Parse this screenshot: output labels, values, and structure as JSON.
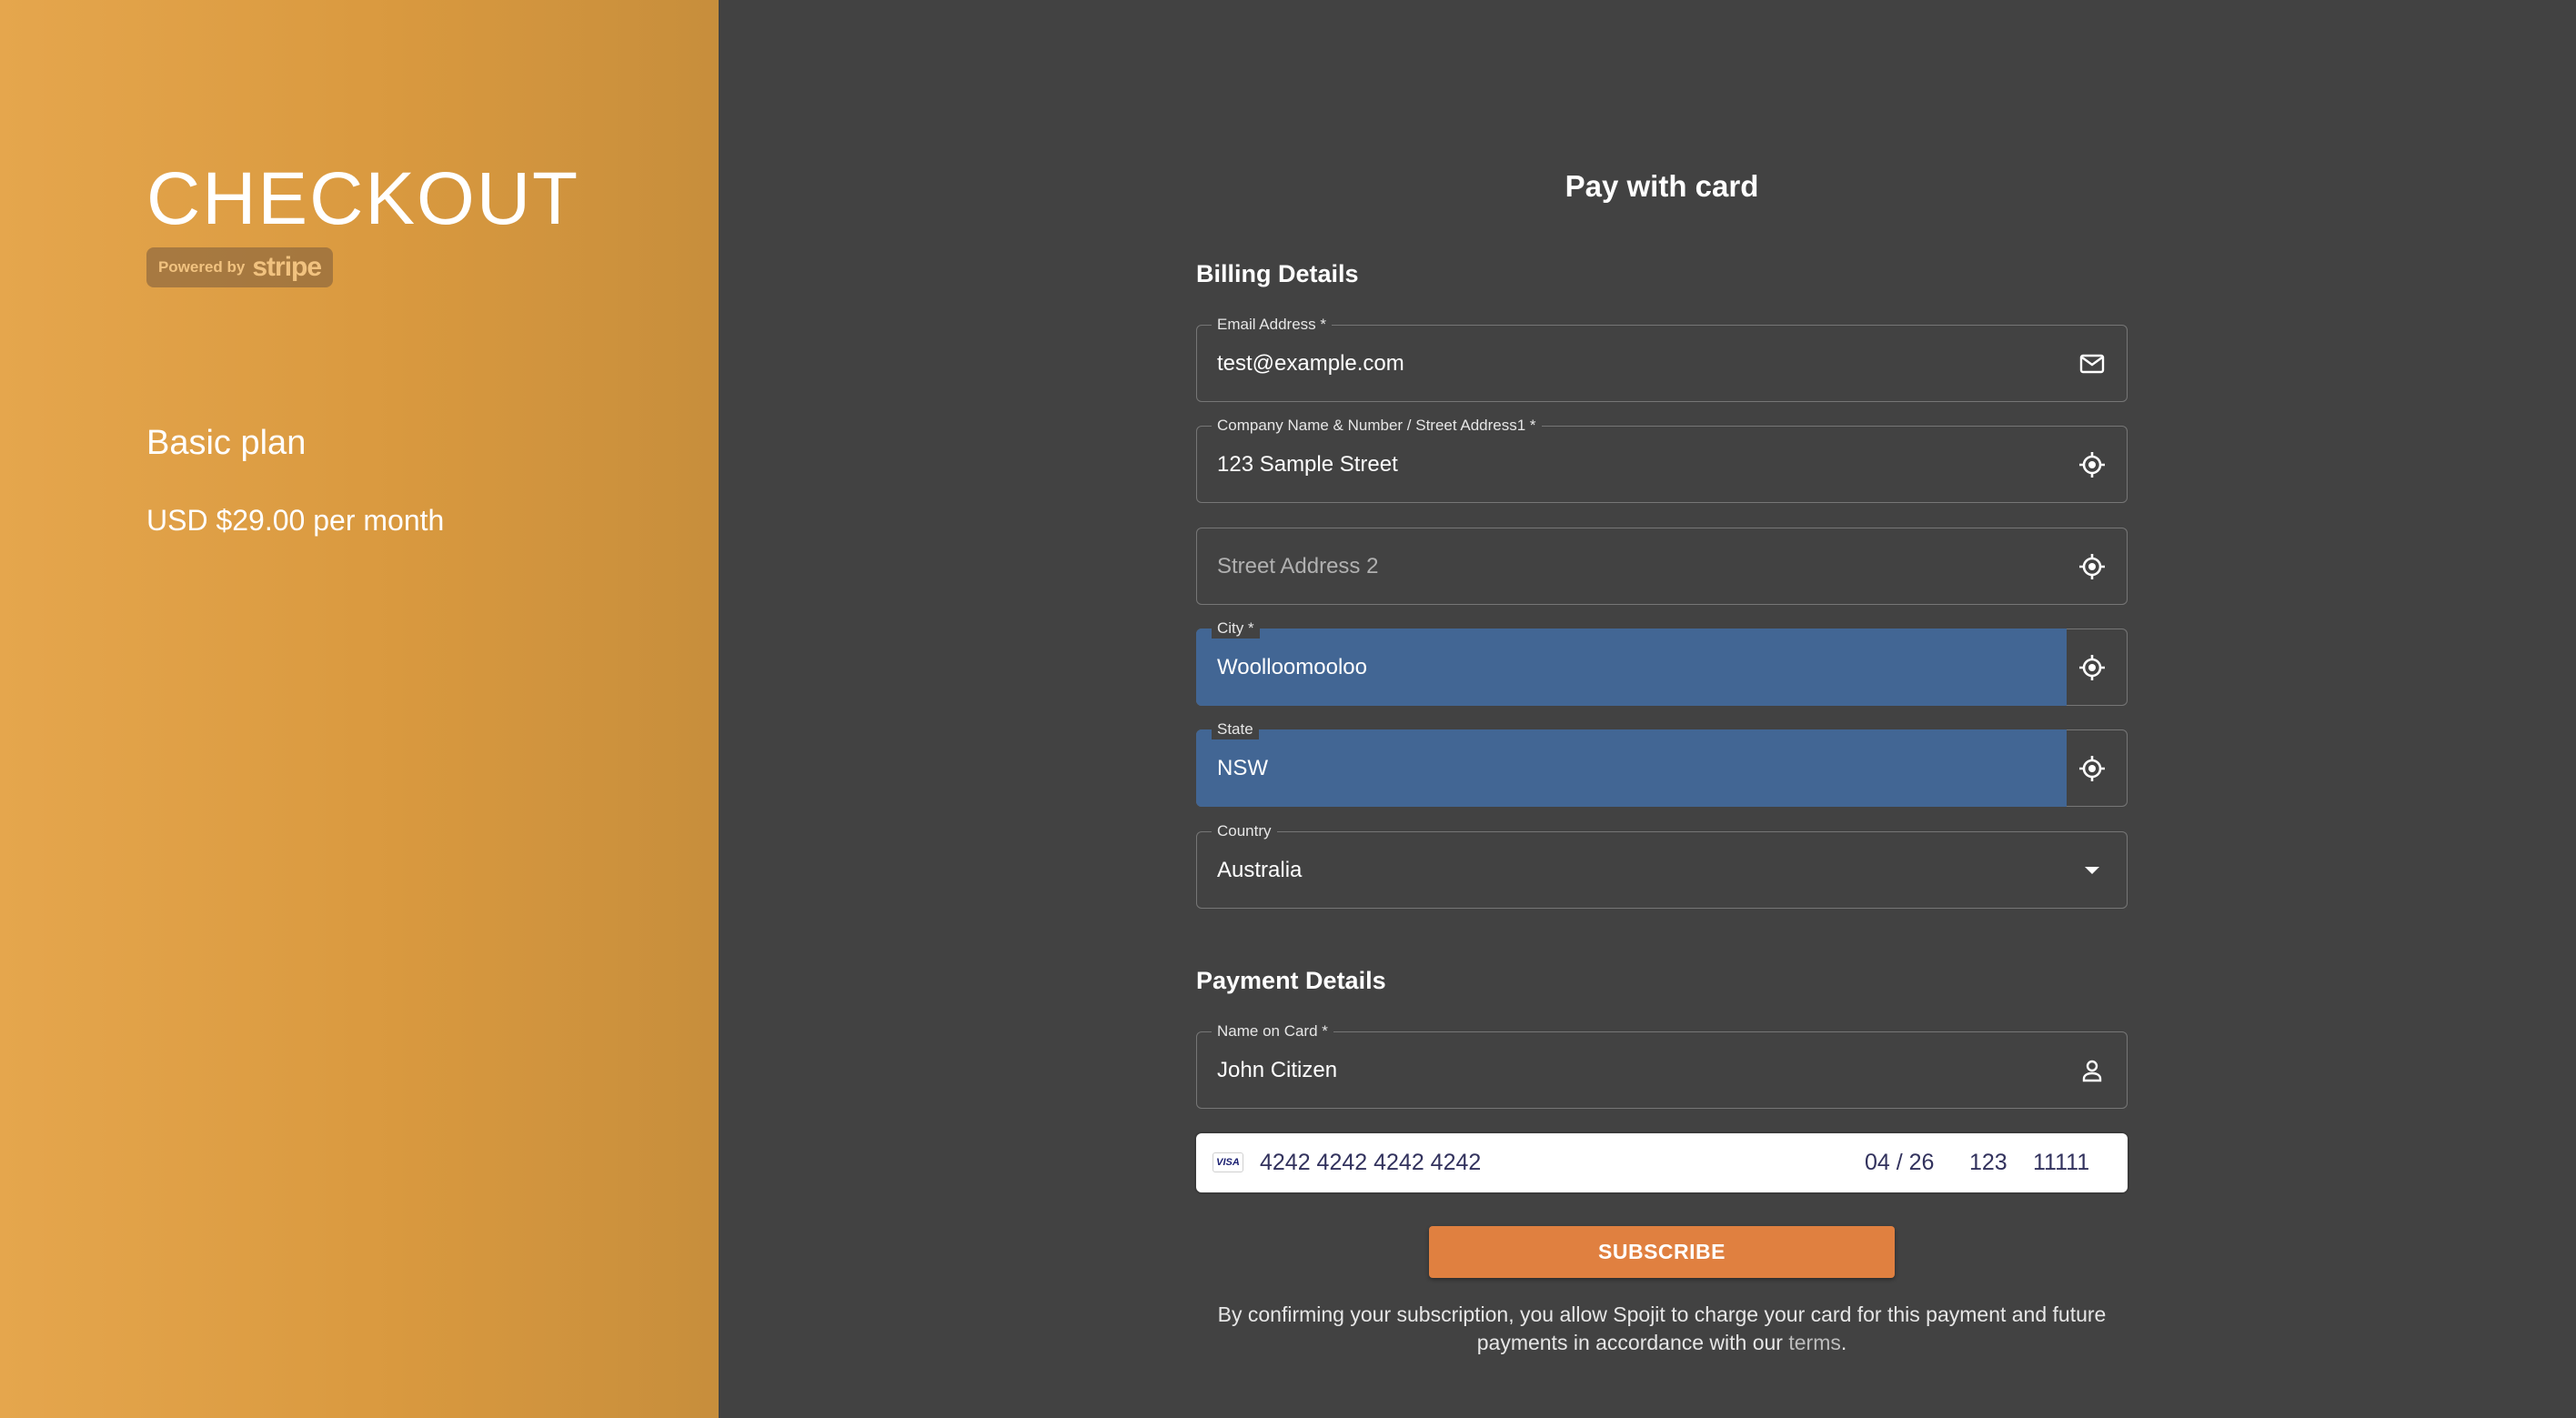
{
  "brand": {
    "title": "CHECKOUT",
    "powered_by": "Powered by",
    "stripe_word": "stripe"
  },
  "plan": {
    "name": "Basic plan",
    "price": "USD $29.00 per month"
  },
  "form": {
    "title": "Pay with card",
    "billing_title": "Billing Details",
    "email": {
      "label": "Email Address *",
      "value": "test@example.com"
    },
    "address1": {
      "label": "Company Name & Number / Street Address1 *",
      "value": "123 Sample Street"
    },
    "address2": {
      "placeholder": "Street Address 2"
    },
    "city": {
      "label": "City *",
      "value": "Woolloomooloo"
    },
    "state": {
      "label": "State",
      "value": "NSW"
    },
    "country": {
      "label": "Country",
      "value": "Australia"
    },
    "payment_title": "Payment Details",
    "name_on_card": {
      "label": "Name on Card *",
      "value": "John Citizen"
    },
    "card": {
      "brand": "VISA",
      "number": "4242 4242 4242 4242",
      "expiry": "04 / 26",
      "cvc": "123",
      "postal": "11111"
    },
    "subscribe_label": "SUBSCRIBE",
    "terms_text": "By confirming your subscription, you allow Spojit to charge your card for this payment and future payments in accordance with our",
    "terms_link": "terms",
    "terms_end": "."
  },
  "colors": {
    "left_panel": "#dda04a",
    "background": "#424242",
    "autofill": "#426694",
    "button": "#e08040"
  }
}
